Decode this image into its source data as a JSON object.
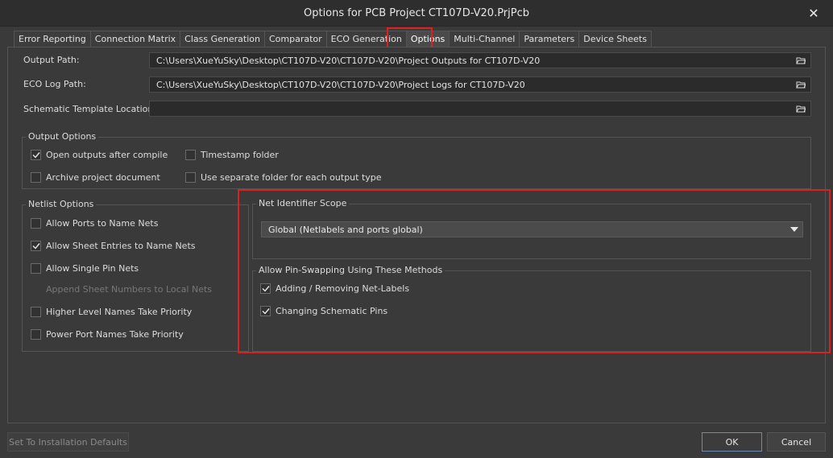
{
  "window": {
    "title": "Options for PCB Project CT107D-V20.PrjPcb"
  },
  "tabs": [
    {
      "label": "Error Reporting",
      "active": false
    },
    {
      "label": "Connection Matrix",
      "active": false
    },
    {
      "label": "Class Generation",
      "active": false
    },
    {
      "label": "Comparator",
      "active": false
    },
    {
      "label": "ECO Generation",
      "active": false
    },
    {
      "label": "Options",
      "active": true
    },
    {
      "label": "Multi-Channel",
      "active": false
    },
    {
      "label": "Parameters",
      "active": false
    },
    {
      "label": "Device Sheets",
      "active": false
    }
  ],
  "paths": {
    "output_label": "Output Path:",
    "output_value": "C:\\Users\\XueYuSky\\Desktop\\CT107D-V20\\CT107D-V20\\Project Outputs for CT107D-V20",
    "eco_label": "ECO Log Path:",
    "eco_value": "C:\\Users\\XueYuSky\\Desktop\\CT107D-V20\\CT107D-V20\\Project Logs for CT107D-V20",
    "template_label": "Schematic Template Location:",
    "template_value": ""
  },
  "output_options": {
    "title": "Output Options",
    "open_outputs": {
      "label": "Open outputs after compile",
      "checked": true
    },
    "timestamp": {
      "label": "Timestamp folder",
      "checked": false
    },
    "archive": {
      "label": "Archive project document",
      "checked": false
    },
    "separate_folder": {
      "label": "Use separate folder for each output type",
      "checked": false
    }
  },
  "netlist_options": {
    "title": "Netlist Options",
    "items": [
      {
        "label": "Allow Ports to Name Nets",
        "checked": false,
        "disabled": false
      },
      {
        "label": "Allow Sheet Entries to Name Nets",
        "checked": true,
        "disabled": false
      },
      {
        "label": "Allow Single Pin Nets",
        "checked": false,
        "disabled": false
      },
      {
        "label": "Append Sheet Numbers to Local Nets",
        "checked": false,
        "disabled": true
      },
      {
        "label": "Higher Level Names Take Priority",
        "checked": false,
        "disabled": false
      },
      {
        "label": "Power Port Names Take Priority",
        "checked": false,
        "disabled": false
      }
    ]
  },
  "net_identifier": {
    "title": "Net Identifier Scope",
    "selected": "Global (Netlabels and ports global)"
  },
  "pin_swap": {
    "title": "Allow Pin-Swapping Using These Methods",
    "adding": {
      "label": "Adding / Removing Net-Labels",
      "checked": true
    },
    "changing": {
      "label": "Changing Schematic Pins",
      "checked": true
    }
  },
  "buttons": {
    "defaults": "Set To Installation Defaults",
    "ok": "OK",
    "cancel": "Cancel"
  },
  "colors": {
    "highlight": "#d62222",
    "background": "#3a3a3a"
  }
}
